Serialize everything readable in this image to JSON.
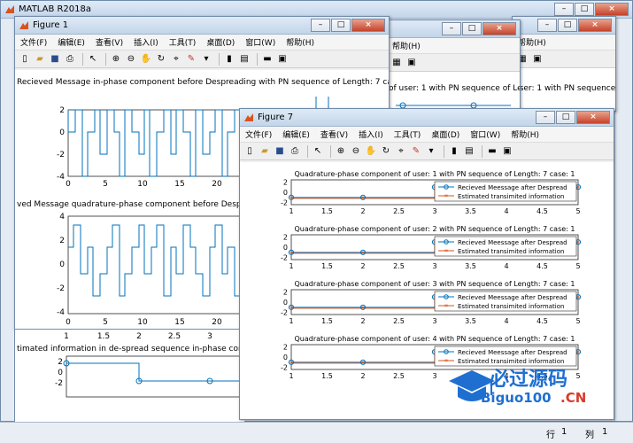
{
  "main_window": {
    "title": "MATLAB R2018a"
  },
  "figure1": {
    "title": "Figure 1",
    "menus": [
      "文件(F)",
      "编辑(E)",
      "查看(V)",
      "插入(I)",
      "工具(T)",
      "桌面(D)",
      "窗口(W)",
      "帮助(H)"
    ],
    "plot1_title": "Recieved Message in-phase component before Despreading  with PN sequence of Length: 7  cas",
    "plot1_yticks": [
      "2",
      "0",
      "-2",
      "-4"
    ],
    "plot1_xticks": [
      "0",
      "5",
      "10",
      "15",
      "20"
    ],
    "plot2_title": "ved Message quadrature-phase component before Despre",
    "plot2_yticks": [
      "4",
      "2",
      "0",
      "-2",
      "-4"
    ],
    "plot2_xticks": [
      "0",
      "5",
      "10",
      "15",
      "20"
    ]
  },
  "figure_mid": {
    "menu_help": "帮助(H)",
    "plot_title": "of user: 1 with PN sequence of Len"
  },
  "figure_right": {
    "menu_help": "帮助(H)",
    "plot_title": "user: 1 with PN sequence of"
  },
  "figure_bottom_left": {
    "xticks": [
      "1",
      "1.5",
      "2",
      "2.5",
      "3"
    ],
    "plot_title": "timated information in de-spread sequence in-phase component",
    "yticks": [
      "2",
      "0",
      "-2"
    ]
  },
  "figure7": {
    "title": "Figure 7",
    "menus": [
      "文件(F)",
      "编辑(E)",
      "查看(V)",
      "插入(I)",
      "工具(T)",
      "桌面(D)",
      "窗口(W)",
      "帮助(H)"
    ],
    "legend": [
      "Recieved Meessage after Despread",
      "Estimated transimited information"
    ],
    "xticks": [
      "1",
      "1.5",
      "2",
      "2.5",
      "3",
      "3.5",
      "4",
      "4.5",
      "5"
    ],
    "yticks": [
      "2",
      "0",
      "-2"
    ],
    "plots": [
      {
        "title": "Quadrature-phase component of user: 1 with PN sequence of Length: 7 case: 1"
      },
      {
        "title": "Quadrature-phase component of user: 2 with PN sequence of Length: 7 case: 1"
      },
      {
        "title": "Quadrature-phase component of user: 3 with PN sequence of Length: 7 case: 1"
      },
      {
        "title": "Quadrature-phase component of user: 4 with PN sequence of Length: 7 case: 1"
      }
    ]
  },
  "watermark": {
    "cn": "必过源码",
    "en": "Biguo100",
    "en_suffix": ".CN"
  },
  "status": {
    "row_label": "行",
    "row_value": "1",
    "col_label": "列",
    "col_value": "1"
  },
  "colors": {
    "blue": "#0072bd",
    "orange": "#d95319"
  }
}
